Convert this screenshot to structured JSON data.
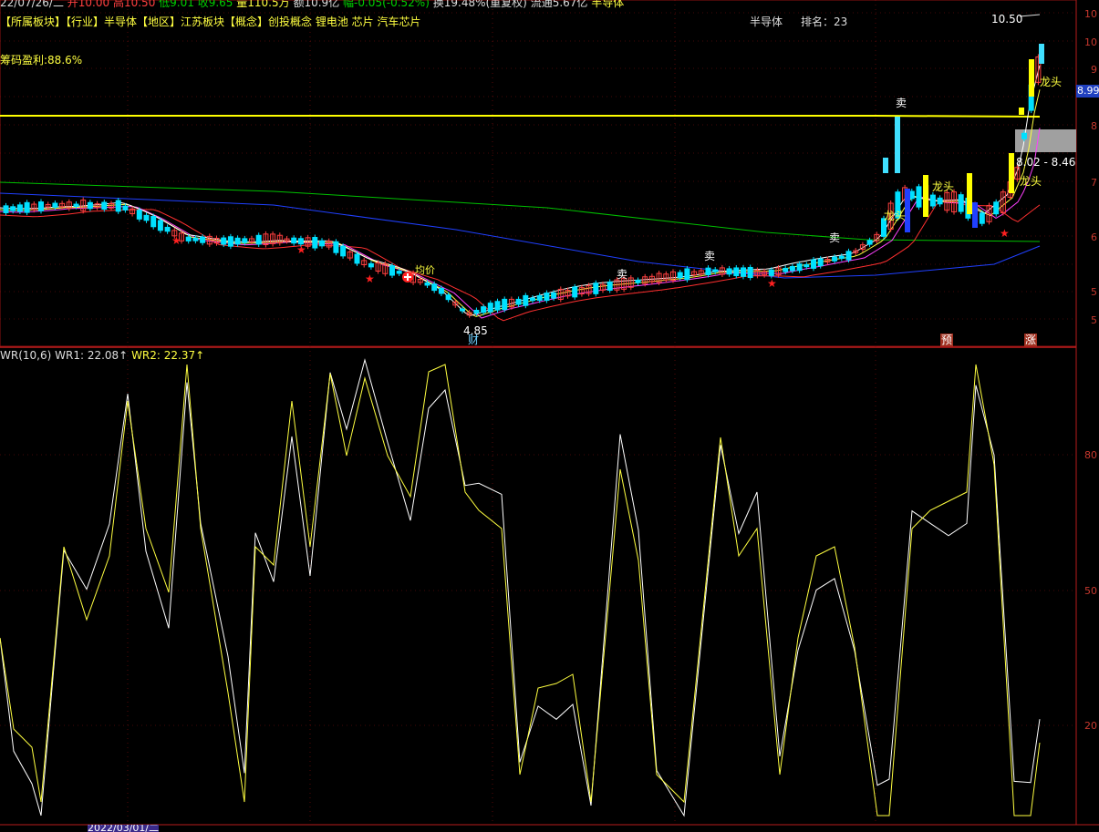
{
  "quote_bar": {
    "date": "22/07/26/二",
    "open": "开10.00",
    "high": "高10.50",
    "low": "低9.01",
    "close": "收9.65",
    "volume": "量110.5万",
    "amount": "额10.9亿",
    "change": "幅-0.05(-0.52%)",
    "turnover": "换19.48%(重复权)",
    "float": "流通5.67亿",
    "sector": "半导体"
  },
  "concept_bar": {
    "text": "【所属板块】【行业】半导体【地区】江苏板块【概念】创投概念 锂电池 芯片 汽车芯片"
  },
  "profit_label": "筹码盈利:88.6%",
  "rank_info": {
    "industry": "半导体",
    "rank_label": "排名：23"
  },
  "chart_annotations": {
    "sell_1": "卖",
    "sell_2": "卖",
    "sell_3": "卖",
    "sell_4": "卖",
    "dragon_1": "龙头",
    "dragon_2": "龙头",
    "dragon_3": "龙头",
    "dragon_4": "龙头",
    "band_label": "8.02 - 8.46",
    "max_label": "10.50",
    "min_label": "4.85",
    "price_tag": "8.99",
    "fin_marker": "财",
    "pre_marker": "预",
    "rise_marker": "涨",
    "ma_label": "均价"
  },
  "indicator_header": {
    "name": "WR(10,6)",
    "wr1": "WR1: 22.08↑",
    "wr2": "WR2: 22.37↑"
  },
  "price_axis": [
    "10",
    "10",
    "9",
    "8",
    "7",
    "6",
    "5",
    "5"
  ],
  "wr_axis": [
    "80",
    "50",
    "20"
  ],
  "date_bar": {
    "date_box": "2022/03/01/二"
  },
  "colors": {
    "up": "#ff4040",
    "down": "#00e0ff",
    "ma5": "#ffffff",
    "ma10": "#ffff40",
    "ma20": "#ff40ff",
    "ma30": "#ff3030",
    "ma60": "#00c000",
    "ma120": "#2040ff",
    "wr1": "#ffffff",
    "wr2": "#ffff40",
    "limit_line": "#ffff00",
    "grid_red": "#8a1010"
  }
}
